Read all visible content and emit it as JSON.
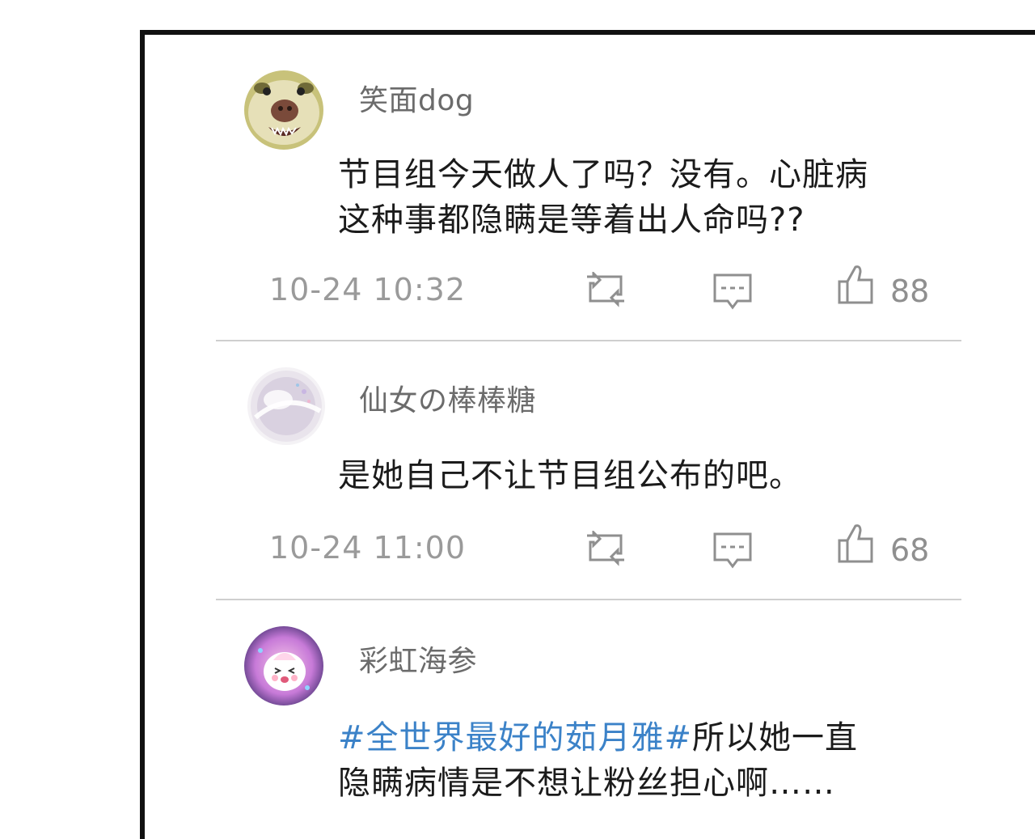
{
  "comments": [
    {
      "username": "笑面dog",
      "avatar_icon": "dog-face-avatar",
      "text": "节目组今天做人了吗？没有。心脏病这种事都隐瞒是等着出人命吗??",
      "hashtag": "",
      "time": "10-24  10:32",
      "likes": "88"
    },
    {
      "username": "仙女の棒棒糖",
      "avatar_icon": "lollipop-avatar",
      "text": "是她自己不让节目组公布的吧。",
      "hashtag": "",
      "time": "10-24 11:00",
      "likes": "68"
    },
    {
      "username": "彩虹海参",
      "avatar_icon": "cartoon-sea-cucumber-avatar",
      "hashtag": "#全世界最好的茹月雅#",
      "text": "所以她一直隐瞒病情是不想让粉丝担心啊……",
      "time": "",
      "likes": ""
    }
  ],
  "icons": {
    "repost": "repost-icon",
    "comment": "comment-icon",
    "like": "thumbs-up-icon"
  },
  "colors": {
    "hashtag": "#3b82c8",
    "username": "#6b6b6b",
    "meta": "#9a9a9a",
    "divider": "#cfcfcf"
  }
}
